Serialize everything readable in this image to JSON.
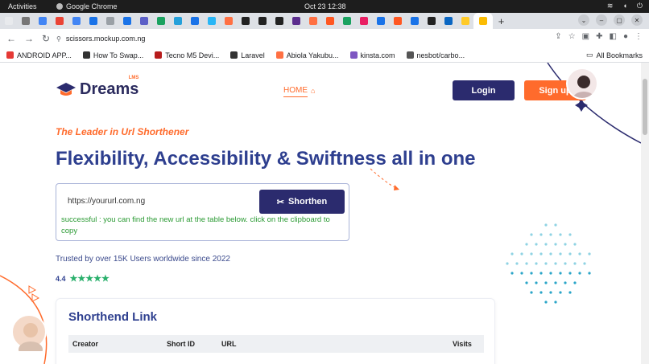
{
  "os": {
    "activities": "Activities",
    "app_name": "Google Chrome",
    "clock": "Oct 23  12:38"
  },
  "browser": {
    "url": "scissors.mockup.com.ng",
    "bookmarks": [
      "ANDROID APP...",
      "How To Swap...",
      "Tecno M5 Devi...",
      "Laravel",
      "Abiola Yakubu...",
      "kinsta.com",
      "nesbot/carbo..."
    ],
    "all_bookmarks": "All Bookmarks",
    "tab_colors": [
      "#e8eaed",
      "#777777",
      "#4285f4",
      "#ea4335",
      "#4285f4",
      "#1a73e8",
      "#9aa0a6",
      "#1a73e8",
      "#5b5fc7",
      "#1aa260",
      "#25a0da",
      "#1a73e8",
      "#29b6f6",
      "#ff7043",
      "#222222",
      "#222222",
      "#222222",
      "#5b2d8e",
      "#ff7043",
      "#ff5722",
      "#1aa260",
      "#e91e63",
      "#1a73e8",
      "#ff5722",
      "#1a73e8",
      "#222222",
      "#0a66c2",
      "#ffca28",
      "#fbbc04"
    ]
  },
  "nav": {
    "logo_text": "Dreams",
    "logo_sup": "LMS",
    "home_label": "HOME",
    "login_label": "Login",
    "signup_label": "Sign up"
  },
  "hero": {
    "tagline": "The Leader in Url Shorthener",
    "headline": "Flexibility, Accessibility & Swiftness all in one",
    "url_value": "https://yoururl.com.ng",
    "shorten_label": "Shorthen",
    "success_message": "successful : you can find the new url at the table below. click on the clipboard to copy",
    "trusted_text": "Trusted by over 15K Users worldwide since 2022",
    "rating": "4.4",
    "stars": 5
  },
  "table": {
    "title": "Shorthend Link",
    "columns": [
      "Creator",
      "Short ID",
      "URL",
      "Visits"
    ]
  },
  "colors": {
    "accent": "#ff6b2c",
    "primary": "#2b2b6e",
    "headline": "#2e3f8f",
    "success": "#2a9a33",
    "star": "#2ab06c"
  }
}
